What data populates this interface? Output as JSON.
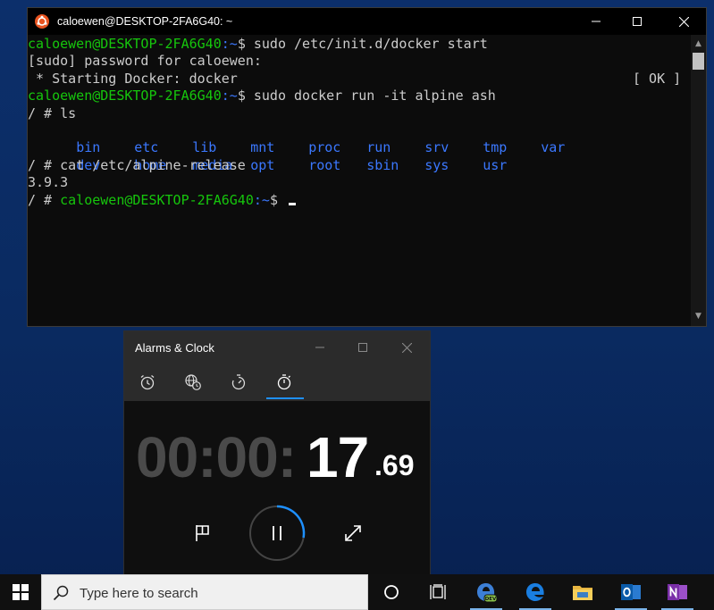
{
  "terminal": {
    "title": "caloewen@DESKTOP-2FA6G40: ~",
    "prompt_user": "caloewen@DESKTOP-2FA6G40",
    "prompt_path": ":~",
    "lines": {
      "l1_cmd": "$ sudo /etc/init.d/docker start",
      "l2": "[sudo] password for caloewen:",
      "l3": " * Starting Docker: docker",
      "l3_ok": "[ OK ]",
      "l4_cmd": "$ sudo docker run -it alpine ash",
      "l5": "/ # ls",
      "ls_row1": [
        "bin",
        "etc",
        "lib",
        "mnt",
        "proc",
        "run",
        "srv",
        "tmp",
        "var"
      ],
      "ls_row2": [
        "dev",
        "home",
        "media",
        "opt",
        "root",
        "sbin",
        "sys",
        "usr"
      ],
      "l8": "/ # cat /etc/alpine-release",
      "l9": "3.9.3",
      "l10_prefix": "/ # ",
      "l10_suffix": "$"
    }
  },
  "clock_app": {
    "title": "Alarms & Clock",
    "tabs": [
      "alarm",
      "world-clock",
      "timer",
      "stopwatch"
    ],
    "selected_tab": "stopwatch",
    "stopwatch": {
      "dim_part": "00:00:",
      "seconds": "17",
      "fraction": ".69"
    },
    "accent_color": "#1e90ff"
  },
  "taskbar": {
    "search_placeholder": "Type here to search",
    "apps": [
      "cortana",
      "task-view",
      "edge-dev",
      "edge",
      "file-explorer",
      "outlook",
      "onenote"
    ]
  },
  "colors": {
    "terminal_green": "#16c60c",
    "terminal_blue": "#3b78ff",
    "desktop_blue": "#0c2f6b"
  }
}
